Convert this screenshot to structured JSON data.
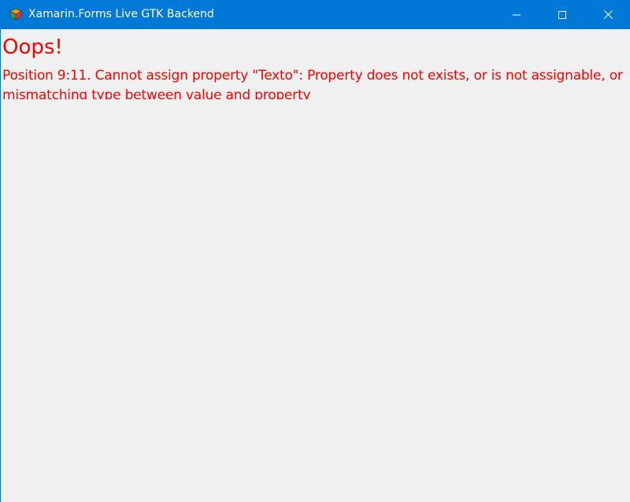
{
  "window": {
    "title": "Xamarin.Forms Live GTK Backend",
    "icon": "gtk-app-icon",
    "titlebar_color": "#0078d7",
    "background_color": "#f0f0f0",
    "caption_buttons": [
      {
        "name": "minimize",
        "icon": "minimize-icon"
      },
      {
        "name": "maximize",
        "icon": "maximize-icon"
      },
      {
        "name": "close",
        "icon": "close-icon"
      }
    ]
  },
  "error": {
    "title": "Oops!",
    "message": "Position 9:11. Cannot assign property \"Texto\": Property does not exists, or is not assignable, or mismatching type between value and property",
    "color": "#ff0000"
  }
}
